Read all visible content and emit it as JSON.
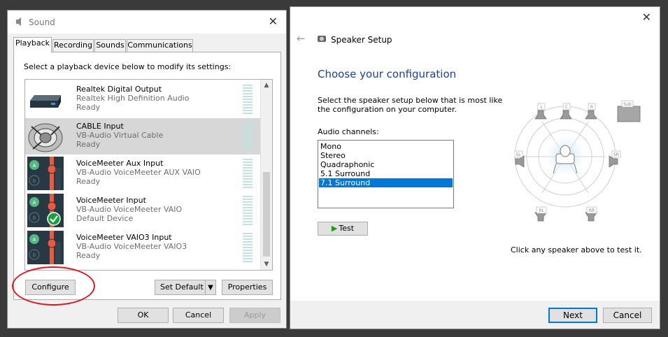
{
  "sound": {
    "title": "Sound",
    "close": "✕",
    "tabs": [
      "Playback",
      "Recording",
      "Sounds",
      "Communications"
    ],
    "instruction": "Select a playback device below to modify its settings:",
    "devices": [
      {
        "name": "Realtek Digital Output",
        "driver": "Realtek High Definition Audio",
        "status": "Ready"
      },
      {
        "name": "CABLE Input",
        "driver": "VB-Audio Virtual Cable",
        "status": "Ready"
      },
      {
        "name": "VoiceMeeter Aux Input",
        "driver": "VB-Audio VoiceMeeter AUX VAIO",
        "status": "Ready"
      },
      {
        "name": "VoiceMeeter Input",
        "driver": "VB-Audio VoiceMeeter VAIO",
        "status": "Default Device"
      },
      {
        "name": "VoiceMeeter VAIO3 Input",
        "driver": "VB-Audio VoiceMeeter VAIO3",
        "status": "Ready"
      }
    ],
    "buttons": {
      "configure": "Configure",
      "set_default": "Set Default",
      "properties": "Properties",
      "ok": "OK",
      "cancel": "Cancel",
      "apply": "Apply"
    }
  },
  "speaker_setup": {
    "title": "Speaker Setup",
    "close": "✕",
    "back": "←",
    "heading": "Choose your configuration",
    "description": "Select the speaker setup below that is most like the configuration on your computer.",
    "channels_label": "Audio channels:",
    "channels": [
      "Mono",
      "Stereo",
      "Quadraphonic",
      "5.1 Surround",
      "7.1 Surround"
    ],
    "selected_channel": "7.1 Surround",
    "test_label": "Test",
    "hint": "Click any speaker above to test it.",
    "speaker_labels": {
      "l": "L",
      "c": "C",
      "r": "R",
      "sub": "Sub",
      "sl": "SL",
      "sr": "SR",
      "rl": "RL",
      "rr": "RR"
    },
    "next": "Next",
    "cancel": "Cancel"
  }
}
